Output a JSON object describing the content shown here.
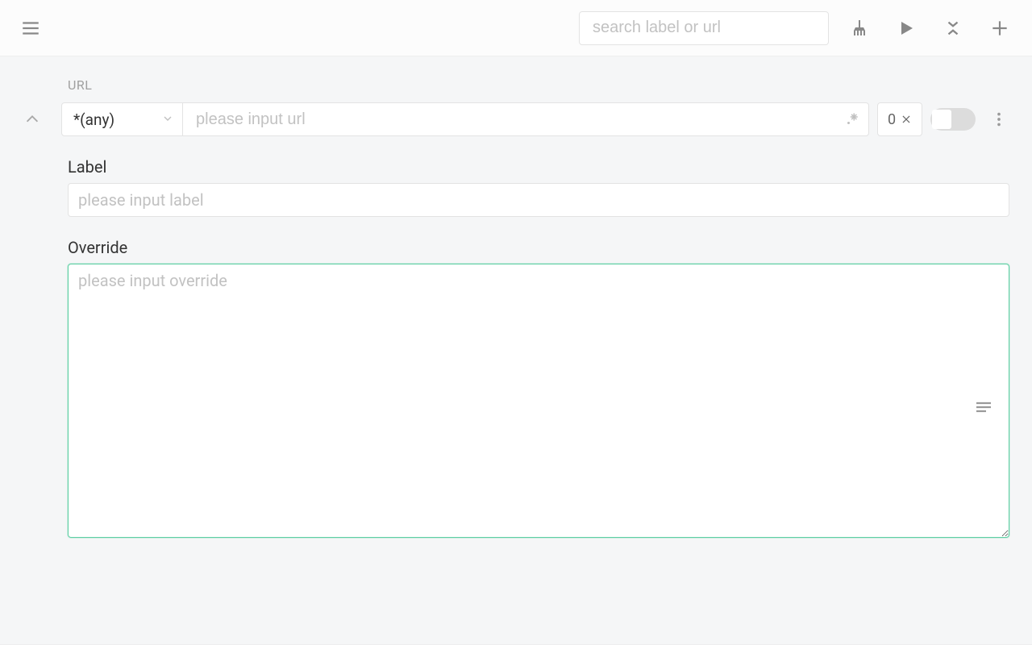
{
  "topbar": {
    "search_placeholder": "search label or url"
  },
  "rule": {
    "url_section_label": "URL",
    "protocol_selected": "*(any)",
    "url_placeholder": "please input url",
    "hit_count": "0",
    "label_heading": "Label",
    "label_placeholder": "please input label",
    "override_heading": "Override",
    "override_placeholder": "please input override"
  }
}
